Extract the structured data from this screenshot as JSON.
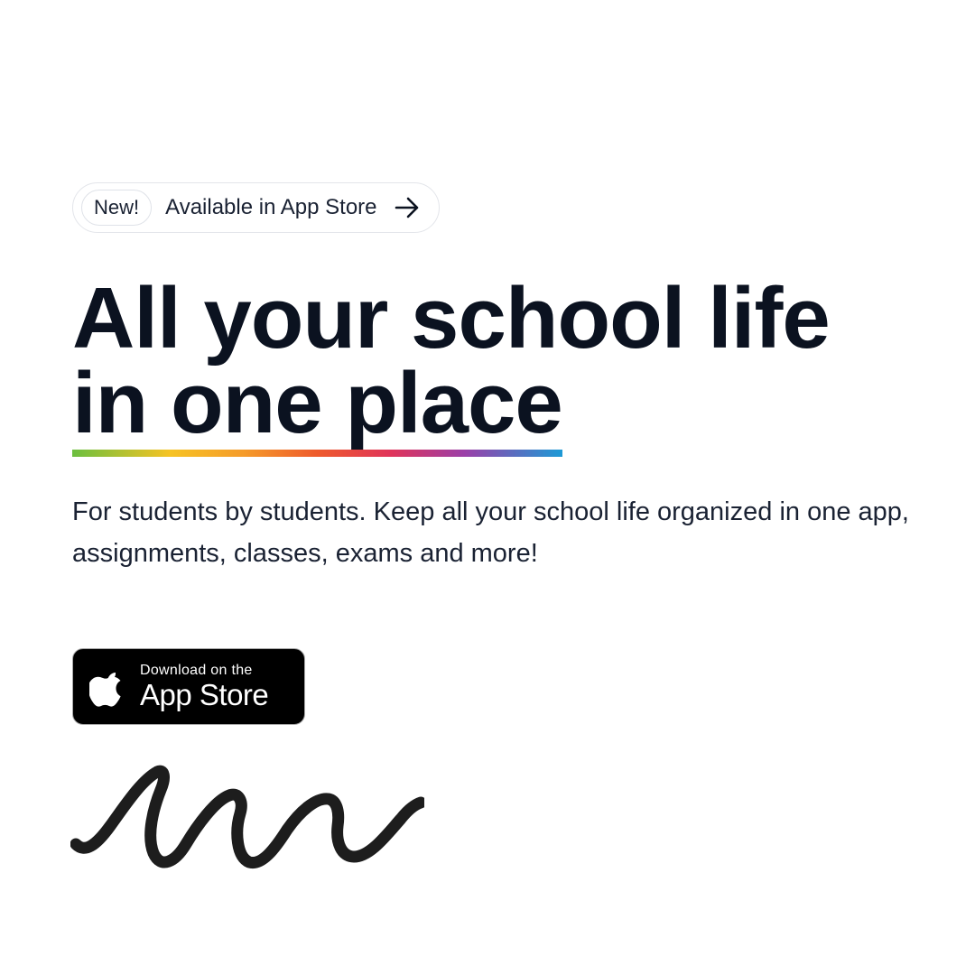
{
  "announcement": {
    "badge": "New!",
    "text": "Available in App Store",
    "icon": "arrow-right-icon"
  },
  "headline": {
    "line1": "All your school life",
    "line2": "in one place"
  },
  "underline_colors": [
    "#6bbf3f",
    "#f6c324",
    "#f59b2a",
    "#ee5a2c",
    "#e0345a",
    "#9b3fa8",
    "#1c9ad6"
  ],
  "subtext": "For students by students. Keep all your school life organized in one app, assignments, classes, exams and more!",
  "app_store_badge": {
    "small_text": "Download on the",
    "large_text": "App Store",
    "icon": "apple-logo-icon"
  },
  "decoration": {
    "icon": "squiggle-icon"
  }
}
